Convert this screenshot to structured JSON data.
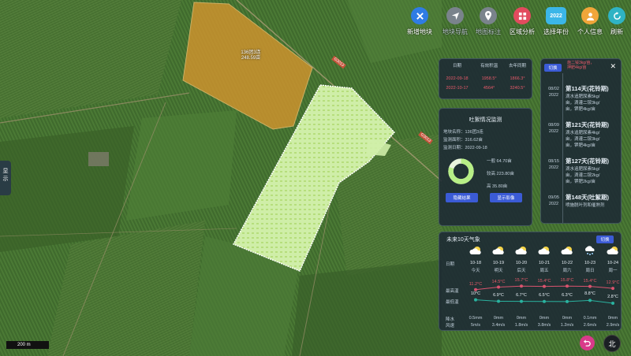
{
  "toolbar": {
    "buttons": [
      {
        "label": "新增地块",
        "icon": "close-cross-icon",
        "color": "#2f7ce4",
        "dim": false
      },
      {
        "label": "地块导航",
        "icon": "navigation-arrow-icon",
        "color": "#7a838c",
        "dim": true
      },
      {
        "label": "地图标注",
        "icon": "map-pin-icon",
        "color": "#7a838c",
        "dim": true
      },
      {
        "label": "区域分析",
        "icon": "grid-icon",
        "color": "#e24b5e",
        "dim": false
      },
      {
        "label": "选择年份",
        "icon": "year-badge-icon",
        "color": "#3bb6e8",
        "dim": false,
        "badge": "2022"
      },
      {
        "label": "个人信息",
        "icon": "user-icon",
        "color": "#f0a63a",
        "dim": false
      },
      {
        "label": "刷新",
        "icon": "refresh-icon",
        "color": "#2fb3c4",
        "dim": false
      }
    ]
  },
  "date_panel": {
    "headers": [
      "日期",
      "有效积温",
      "去年同期"
    ],
    "rows": [
      {
        "date": "2022-09-18",
        "value": "1958.5°",
        "last": "1866.3°"
      },
      {
        "date": "2022-10-17",
        "value": "4564°",
        "last": "3240.5°"
      }
    ]
  },
  "monitor_panel": {
    "title": "吐絮情况监测",
    "lines": [
      "地块名称：136团3连",
      "监测面积：316.62亩",
      "监测日期：2022-09-18"
    ],
    "legend": [
      {
        "label": "一般",
        "value": "64.70亩"
      },
      {
        "label": "较高",
        "value": "223.80亩"
      },
      {
        "label": "高",
        "value": "35.80亩"
      }
    ],
    "buttons": {
      "result": "隐藏结果",
      "image": "显示影像"
    },
    "colors": {
      "ring": "#b7ef86",
      "gap": "#e8f4dc"
    }
  },
  "growth_panel": {
    "switch_label": "切换",
    "top_text": [
      "施二铵3kg/亩，",
      "押肥4kg/亩"
    ],
    "items": [
      {
        "date": "08/02",
        "year": "2022",
        "title": "第114天(花铃期)",
        "body": [
          "滴水追肥尿素5kg/",
          "亩，滴灌二铵3kg/",
          "亩，钾肥4kg/亩"
        ]
      },
      {
        "date": "08/09",
        "year": "2022",
        "title": "第121天(花铃期)",
        "body": [
          "滴水追肥尿素4kg/",
          "亩，滴灌二铵3kg/",
          "亩，钾肥4kg/亩"
        ]
      },
      {
        "date": "08/15",
        "year": "2022",
        "title": "第127天(花铃期)",
        "body": [
          "滴水追肥尿素5kg/",
          "亩，滴灌二铵2kg/",
          "亩，钾肥2kg/亩"
        ]
      },
      {
        "date": "09/05",
        "year": "2022",
        "title": "第148天(吐絮期)",
        "body": [
          "喷施脱叶剂和催熟剂"
        ]
      }
    ]
  },
  "weather_panel": {
    "title": "未来10天气象",
    "switch_label": "切换",
    "row_labels": {
      "date": "日期",
      "high": "最高温",
      "low": "最低温",
      "rain": "降水",
      "wind": "风速"
    },
    "days": [
      {
        "date": "10-18",
        "label": "今天",
        "icon": "cloudy-icon",
        "high": 11.2,
        "high_text": "11.2°C",
        "low": 10.0,
        "low_text": "10°C",
        "rain": "0.5mm",
        "wind": "5m/s"
      },
      {
        "date": "10-19",
        "label": "明天",
        "icon": "cloudy-icon",
        "high": 14.5,
        "high_text": "14.5°C",
        "low": 6.9,
        "low_text": "6.9°C",
        "rain": "0mm",
        "wind": "3.4m/s"
      },
      {
        "date": "10-20",
        "label": "后天",
        "icon": "cloudy-icon",
        "high": 15.7,
        "high_text": "15.7°C",
        "low": 6.7,
        "low_text": "6.7°C",
        "rain": "0mm",
        "wind": "1.8m/s"
      },
      {
        "date": "10-21",
        "label": "周五",
        "icon": "cloudy-icon",
        "high": 15.4,
        "high_text": "15.4°C",
        "low": 6.5,
        "low_text": "6.5°C",
        "rain": "0mm",
        "wind": "3.8m/s"
      },
      {
        "date": "10-22",
        "label": "周六",
        "icon": "cloudy-icon",
        "high": 15.8,
        "high_text": "15.8°C",
        "low": 6.3,
        "low_text": "6.3°C",
        "rain": "0mm",
        "wind": "1.2m/s"
      },
      {
        "date": "10-23",
        "label": "周日",
        "icon": "snow-icon",
        "high": 15.4,
        "high_text": "15.4°C",
        "low": 8.8,
        "low_text": "8.8°C",
        "rain": "0.1mm",
        "wind": "2.6m/s"
      },
      {
        "date": "10-24",
        "label": "周一",
        "icon": "cloudy-icon",
        "high": 12.9,
        "high_text": "12.9°C",
        "low": 2.8,
        "low_text": "2.8°C",
        "rain": "0mm",
        "wind": "2.9m/s"
      }
    ],
    "colors": {
      "high": "#d9536e",
      "low": "#2ab3a0"
    }
  },
  "map": {
    "field_label": [
      "136团3连",
      "248.59亩"
    ],
    "road_labels": [
      "G3013",
      "G3013"
    ],
    "colors": {
      "orange_field": "#d9962e",
      "analyzed": "#cfeea8"
    }
  },
  "show_tab": [
    "显",
    "示"
  ],
  "scale_label": "200 m",
  "north_label": "北",
  "back_icon": "back-arrow-icon"
}
